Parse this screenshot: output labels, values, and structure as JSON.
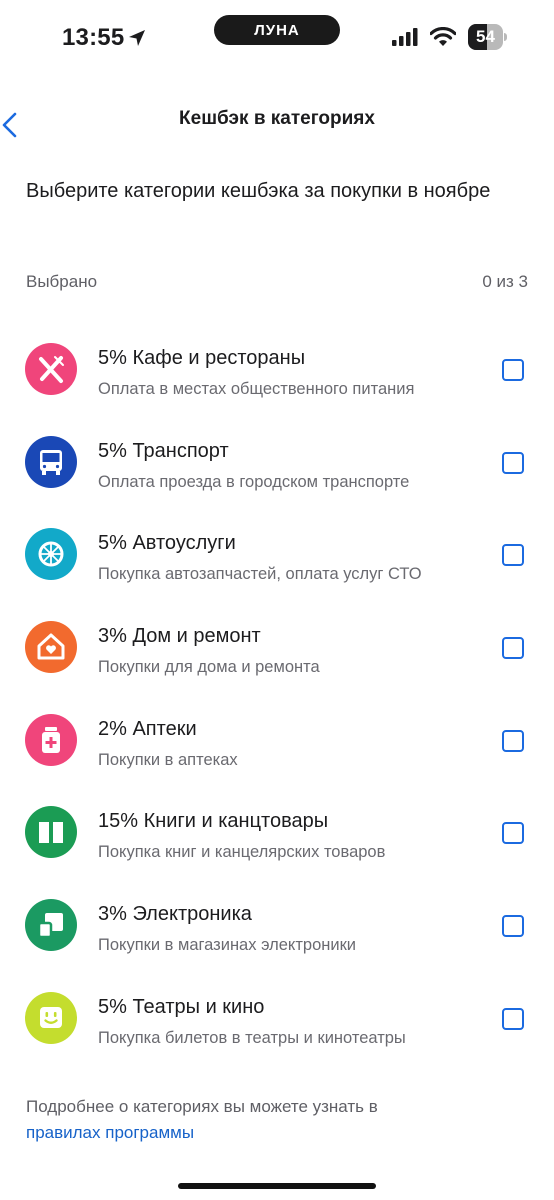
{
  "status": {
    "time": "13:55",
    "island_label": "ЛУНА",
    "battery": "54",
    "battery_level": 0.54
  },
  "nav": {
    "title": "Кешбэк в категориях"
  },
  "intro": "Выберите категории кешбэка за покупки в ноябре",
  "selected": {
    "label": "Выбрано",
    "count": "0 из 3"
  },
  "categories": [
    {
      "title": "5% Кафе и рестораны",
      "subtitle": "Оплата в местах общественного питания",
      "icon": "fork-knife-icon",
      "color": "#f0457b",
      "checked": false
    },
    {
      "title": "5% Транспорт",
      "subtitle": "Оплата проезда в городском транспорте",
      "icon": "bus-icon",
      "color": "#1a48b6",
      "checked": false
    },
    {
      "title": "5% Автоуслуги",
      "subtitle": "Покупка автозапчастей, оплата услуг СТО",
      "icon": "wheel-icon",
      "color": "#12a9c9",
      "checked": false
    },
    {
      "title": "3% Дом и ремонт",
      "subtitle": "Покупки для дома и ремонта",
      "icon": "home-heart-icon",
      "color": "#f26a2e",
      "checked": false
    },
    {
      "title": "2% Аптеки",
      "subtitle": "Покупки в аптеках",
      "icon": "medicine-icon",
      "color": "#f0457b",
      "checked": false
    },
    {
      "title": "15% Книги и канцтовары",
      "subtitle": "Покупка книг и канцелярских товаров",
      "icon": "book-icon",
      "color": "#1b9c54",
      "checked": false
    },
    {
      "title": "3% Электроника",
      "subtitle": "Покупки в магазинах электроники",
      "icon": "devices-icon",
      "color": "#1b9a62",
      "checked": false
    },
    {
      "title": "5% Театры и кино",
      "subtitle": "Покупка билетов в театры и кинотеатры",
      "icon": "smile-screen-icon",
      "color": "#c4dd2e",
      "checked": false
    }
  ],
  "footer": {
    "text": "Подробнее о категориях вы можете узнать в",
    "link": "правилах программы"
  }
}
